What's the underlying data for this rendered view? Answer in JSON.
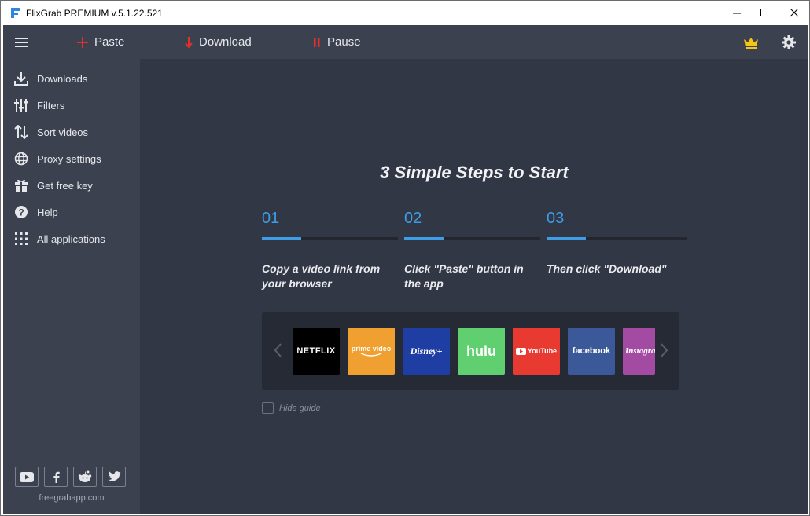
{
  "window": {
    "title": "FlixGrab PREMIUM  v.5.1.22.521"
  },
  "toolbar": {
    "paste_label": "Paste",
    "download_label": "Download",
    "pause_label": "Pause"
  },
  "sidebar": {
    "items": [
      {
        "label": "Downloads",
        "icon": "download-icon"
      },
      {
        "label": "Filters",
        "icon": "filters-icon"
      },
      {
        "label": "Sort videos",
        "icon": "sort-icon"
      },
      {
        "label": "Proxy settings",
        "icon": "globe-icon"
      },
      {
        "label": "Get free key",
        "icon": "gift-icon"
      },
      {
        "label": "Help",
        "icon": "help-icon"
      },
      {
        "label": "All applications",
        "icon": "grid-icon"
      }
    ],
    "socials": [
      "youtube-icon",
      "facebook-icon",
      "reddit-icon",
      "twitter-icon"
    ],
    "site": "freegrabapp.com"
  },
  "guide": {
    "heading": "3 Simple Steps to Start",
    "steps": [
      {
        "number": "01",
        "text": "Copy a video link from your browser"
      },
      {
        "number": "02",
        "text": "Click \"Paste\" button in the app"
      },
      {
        "number": "03",
        "text": "Then click \"Download\""
      }
    ],
    "services": [
      {
        "name": "NETFLIX",
        "color": "#000000"
      },
      {
        "name": "prime video",
        "color": "#f0a030"
      },
      {
        "name": "Disney+",
        "color": "#1f3ea3"
      },
      {
        "name": "hulu",
        "color": "#5fcf6f"
      },
      {
        "name": "YouTube",
        "color": "#e83a31"
      },
      {
        "name": "facebook",
        "color": "#3b5998"
      },
      {
        "name": "Instagram",
        "color": "#a34aa3"
      }
    ],
    "hide_guide_label": "Hide guide"
  },
  "colors": {
    "accent": "#3d9ee5",
    "sidebar_bg": "#3c4150",
    "main_bg": "#323745",
    "crown": "#f5c518",
    "red": "#e5302a"
  }
}
